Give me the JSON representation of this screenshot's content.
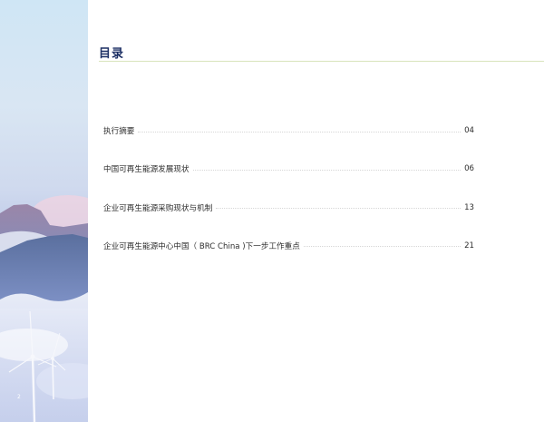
{
  "title": "目录",
  "page_number": "2",
  "toc": [
    {
      "label": "执行摘要",
      "page": "04"
    },
    {
      "label": "中国可再生能源发展现状",
      "page": "06"
    },
    {
      "label": "企业可再生能源采购现状与机制",
      "page": "13"
    },
    {
      "label": "企业可再生能源中心中国（ BRC China )下一步工作重点",
      "page": "21"
    }
  ]
}
